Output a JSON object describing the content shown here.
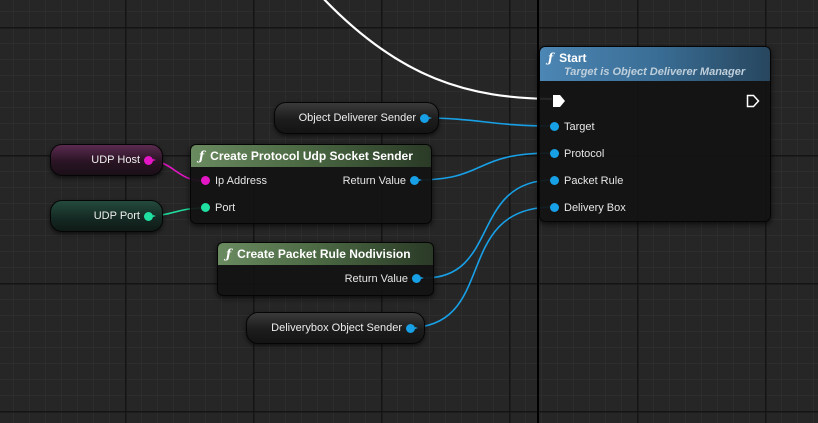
{
  "nodes": {
    "start": {
      "title": "Start",
      "subtitle": "Target is Object Deliverer Manager",
      "pins": [
        "Target",
        "Protocol",
        "Packet Rule",
        "Delivery Box"
      ]
    },
    "create_udp": {
      "title": "Create Protocol Udp Socket Sender",
      "in_pins": [
        "Ip Address",
        "Port"
      ],
      "out_pin": "Return Value"
    },
    "create_packet_rule": {
      "title": "Create Packet Rule Nodivision",
      "out_pin": "Return Value"
    }
  },
  "variables": {
    "sender": "Object Deliverer Sender",
    "udp_host": "UDP Host",
    "udp_port": "UDP Port",
    "deliverybox": "Deliverybox Object Sender"
  },
  "icons": {
    "function": "function-icon",
    "exec": "exec-pin-icon"
  },
  "colors": {
    "object_pin": "#18a0e6",
    "string_pin": "#e516c6",
    "int_pin": "#1fe0a0",
    "function_header": "#3a6e96",
    "pure_header": "#5a7a50",
    "exec_wire": "#ffffff"
  }
}
